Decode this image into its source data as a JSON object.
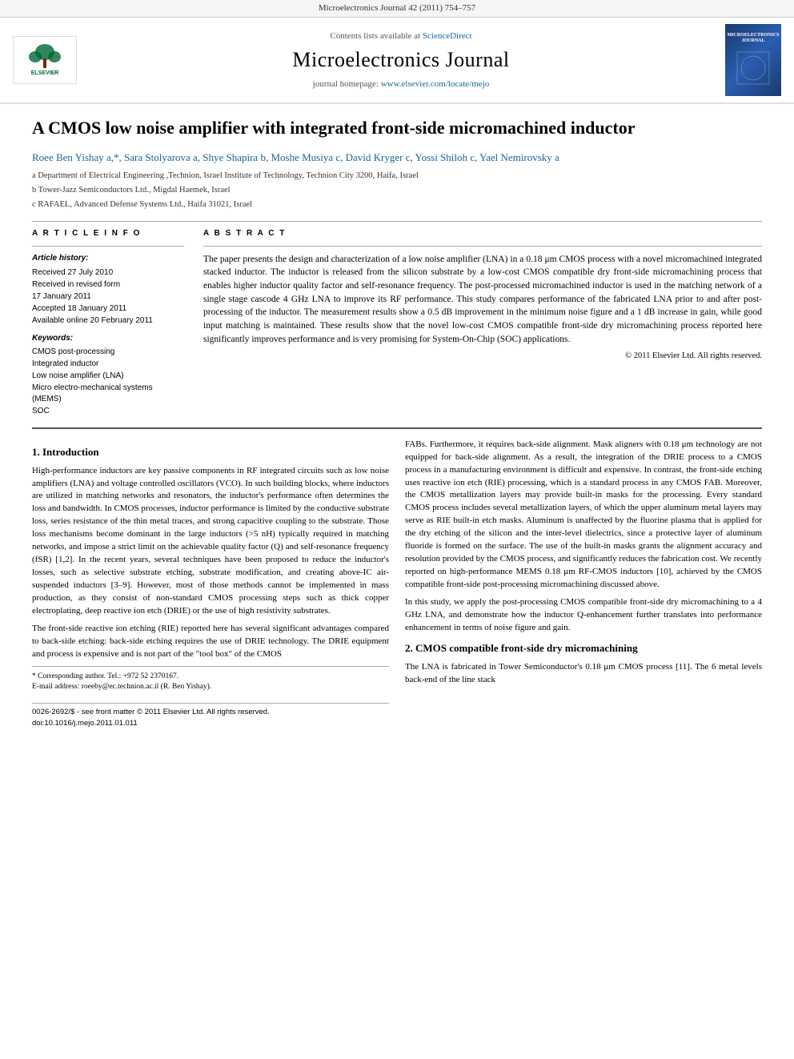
{
  "header_bar": {
    "citation": "Microelectronics Journal 42 (2011) 754–757"
  },
  "banner": {
    "contents_text": "Contents lists available at",
    "sciencedirect": "ScienceDirect",
    "journal_title": "Microelectronics Journal",
    "homepage_label": "journal homepage:",
    "homepage_url": "www.elsevier.com/locate/mejo"
  },
  "elsevier_logo_text": "ELSEVIER",
  "journal_cover_lines": [
    "MICROELECTRONICS",
    "JOURNAL"
  ],
  "paper": {
    "title": "A CMOS low noise amplifier with integrated front-side micromachined inductor",
    "authors": "Roee Ben Yishay a,*, Sara Stolyarova a, Shye Shapira b, Moshe Musiya c, David Kryger c, Yossi Shiloh c, Yael Nemirovsky a",
    "affiliations": [
      "a Department of Electrical Engineering ,Technion, Israel Institute of Technology, Technion City 3200, Haifa, Israel",
      "b Tower-Jazz Semiconductors Ltd., Migdal Haemek, Israel",
      "c RAFAEL, Advanced Defense Systems Ltd., Haifa 31021, Israel"
    ]
  },
  "article_info": {
    "section_heading": "A R T I C L E   I N F O",
    "history_label": "Article history:",
    "received": "Received 27 July 2010",
    "received_revised": "Received in revised form",
    "received_revised_date": "17 January 2011",
    "accepted": "Accepted 18 January 2011",
    "available": "Available online 20 February 2011",
    "keywords_label": "Keywords:",
    "keywords": [
      "CMOS post-processing",
      "Integrated inductor",
      "Low noise amplifier (LNA)",
      "Micro electro-mechanical systems (MEMS)",
      "SOC"
    ]
  },
  "abstract": {
    "section_heading": "A B S T R A C T",
    "text": "The paper presents the design and characterization of a low noise amplifier (LNA) in a 0.18 μm CMOS process with a novel micromachined integrated stacked inductor. The inductor is released from the silicon substrate by a low-cost CMOS compatible dry front-side micromachining process that enables higher inductor quality factor and self-resonance frequency. The post-processed micromachined inductor is used in the matching network of a single stage cascode 4 GHz LNA to improve its RF performance. This study compares performance of the fabricated LNA prior to and after post-processing of the inductor. The measurement results show a 0.5 dB improvement in the minimum noise figure and a 1 dB increase in gain, while good input matching is maintained. These results show that the novel low-cost CMOS compatible front-side dry micromachining process reported here significantly improves performance and is very promising for System-On-Chip (SOC) applications.",
    "copyright": "© 2011 Elsevier Ltd. All rights reserved."
  },
  "body": {
    "intro_heading": "1.  Introduction",
    "intro_col1_p1": "High-performance inductors are key passive components in RF integrated circuits such as low noise amplifiers (LNA) and voltage controlled oscillators (VCO). In such building blocks, where inductors are utilized in matching networks and resonators, the inductor's performance often determines the loss and bandwidth. In CMOS processes, inductor performance is limited by the conductive substrate loss, series resistance of the thin metal traces, and strong capacitive coupling to the substrate. Those loss mechanisms become dominant in the large inductors (>5 nH) typically required in matching networks, and impose a strict limit on the achievable quality factor (Q) and self-resonance frequency (fSR) [1,2]. In the recent years, several techniques have been proposed to reduce the inductor's losses, such as selective substrate etching, substrate modification, and creating above-IC air-suspended inductors [3–9]. However, most of those methods cannot be implemented in mass production, as they consist of non-standard CMOS processing steps such as thick copper electroplating, deep reactive ion etch (DRIE) or the use of high resistivity substrates.",
    "intro_col1_p2": "The front-side reactive ion etching (RIE) reported here has several significant advantages compared to back-side etching: back-side etching requires the use of DRIE technology. The DRIE equipment and process is expensive and is not part of the \"tool box\" of the CMOS",
    "intro_col2_p1": "FABs. Furthermore, it requires back-side alignment. Mask aligners with 0.18 μm technology are not equipped for back-side alignment. As a result, the integration of the DRIE process to a CMOS process in a manufacturing environment is difficult and expensive. In contrast, the front-side etching uses reactive ion etch (RIE) processing, which is a standard process in any CMOS FAB. Moreover, the CMOS metallization layers may provide built-in masks for the processing. Every standard CMOS process includes several metallization layers, of which the upper aluminum metal layers may serve as RIE built-in etch masks. Aluminum is unaffected by the fluorine plasma that is applied for the dry etching of the silicon and the inter-level dielectrics, since a protective layer of aluminum fluoride is formed on the surface. The use of the built-in masks grants the alignment accuracy and resolution provided by the CMOS process, and significantly reduces the fabrication cost. We recently reported on high-performance MEMS 0.18 μm RF-CMOS inductors [10], achieved by the CMOS compatible front-side post-processing micromachining discussed above.",
    "intro_col2_p2": "In this study, we apply the post-processing CMOS compatible front-side dry micromachining to a 4 GHz LNA, and demonstrate how the inductor Q-enhancement further translates into performance enhancement in terms of noise figure and gain.",
    "section2_heading": "2.  CMOS compatible front-side dry micromachining",
    "section2_col2_p1": "The LNA is fabricated in Tower Semiconductor's 0.18 μm CMOS process [11]. The 6 metal levels back-end of the line stack"
  },
  "footnote": {
    "star": "* Corresponding author. Tel.: +972 52 2370167.",
    "email": "E-mail address: roeeby@ec.technion.ac.il (R. Ben Yishay).",
    "bottom_bar1": "0026-2692/$ - see front matter © 2011 Elsevier Ltd. All rights reserved.",
    "bottom_bar2": "doi:10.1016/j.mejo.2011.01.011"
  }
}
